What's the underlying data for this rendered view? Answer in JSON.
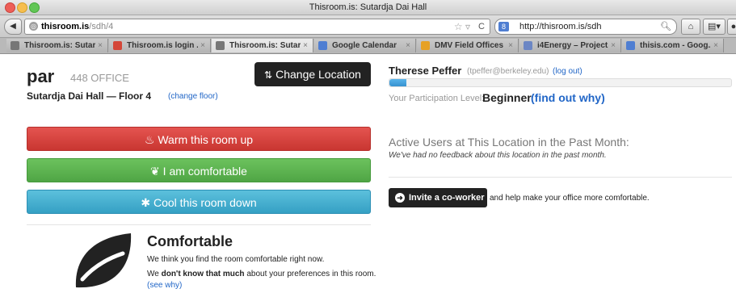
{
  "browser": {
    "window_title": "Thisroom.is: Sutardja Dai Hall",
    "url_host": "thisroom.is",
    "url_path": "/sdh/4",
    "search_text": "http://thisroom.is/sdh",
    "tabs": [
      {
        "label": "Thisroom.is: Sutar...",
        "icon_color": "#777777",
        "active": false
      },
      {
        "label": "Thisroom.is login ...",
        "icon_color": "#d44638",
        "active": false
      },
      {
        "label": "Thisroom.is: Sutar...",
        "icon_color": "#777777",
        "active": true
      },
      {
        "label": "Google Calendar",
        "icon_color": "#4f7ed2",
        "active": false
      },
      {
        "label": "DMV Field Offices",
        "icon_color": "#e6a125",
        "active": false
      },
      {
        "label": "i4Energy – Project...",
        "icon_color": "#6b86c4",
        "active": false
      },
      {
        "label": "thisis.com - Goog...",
        "icon_color": "#4f7ed2",
        "active": false
      }
    ]
  },
  "room": {
    "code": "par",
    "type": "448 OFFICE",
    "building": "Sutardja Dai Hall — Floor 4",
    "change_floor": "(change floor)",
    "change_location": "Change Location"
  },
  "user": {
    "name": "Therese Peffer",
    "email": "(tpeffer@berkeley.edu)",
    "logout": "(log out)",
    "progress_percent": 5,
    "level_label": "Your Participation Level:",
    "level_value": "Beginner",
    "level_why": "(find out why)"
  },
  "actions": {
    "warm": "Warm this room up",
    "comfortable": "I am comfortable",
    "cool": "Cool this room down"
  },
  "status": {
    "title": "Comfortable",
    "line1": "We think you find the room comfortable right now.",
    "line2_pre": "We ",
    "line2_bold": "don't know that much",
    "line2_post": " about your preferences in this room. ",
    "see_why": "(see why)"
  },
  "active_users": {
    "title": "Active Users at This Location in the Past Month:",
    "message": "We've had no feedback about this location in the past month."
  },
  "invite": {
    "button": "Invite a co-worker",
    "text": "and help make your office more comfortable."
  },
  "colors": {
    "warm": "#d9423e",
    "comfortable": "#5cb350",
    "cool": "#3aa6cb",
    "link": "#2166c7"
  }
}
